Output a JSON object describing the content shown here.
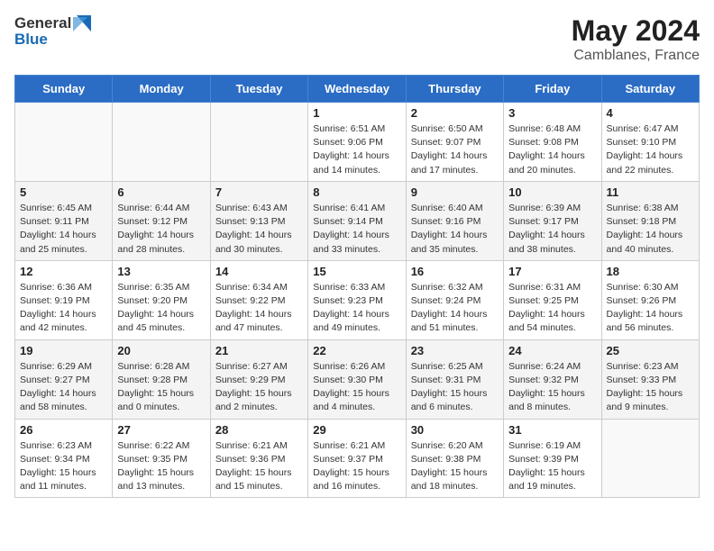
{
  "header": {
    "logo_line1": "General",
    "logo_line2": "Blue",
    "month": "May 2024",
    "location": "Camblanes, France"
  },
  "weekdays": [
    "Sunday",
    "Monday",
    "Tuesday",
    "Wednesday",
    "Thursday",
    "Friday",
    "Saturday"
  ],
  "weeks": [
    [
      {
        "day": "",
        "info": ""
      },
      {
        "day": "",
        "info": ""
      },
      {
        "day": "",
        "info": ""
      },
      {
        "day": "1",
        "info": "Sunrise: 6:51 AM\nSunset: 9:06 PM\nDaylight: 14 hours\nand 14 minutes."
      },
      {
        "day": "2",
        "info": "Sunrise: 6:50 AM\nSunset: 9:07 PM\nDaylight: 14 hours\nand 17 minutes."
      },
      {
        "day": "3",
        "info": "Sunrise: 6:48 AM\nSunset: 9:08 PM\nDaylight: 14 hours\nand 20 minutes."
      },
      {
        "day": "4",
        "info": "Sunrise: 6:47 AM\nSunset: 9:10 PM\nDaylight: 14 hours\nand 22 minutes."
      }
    ],
    [
      {
        "day": "5",
        "info": "Sunrise: 6:45 AM\nSunset: 9:11 PM\nDaylight: 14 hours\nand 25 minutes."
      },
      {
        "day": "6",
        "info": "Sunrise: 6:44 AM\nSunset: 9:12 PM\nDaylight: 14 hours\nand 28 minutes."
      },
      {
        "day": "7",
        "info": "Sunrise: 6:43 AM\nSunset: 9:13 PM\nDaylight: 14 hours\nand 30 minutes."
      },
      {
        "day": "8",
        "info": "Sunrise: 6:41 AM\nSunset: 9:14 PM\nDaylight: 14 hours\nand 33 minutes."
      },
      {
        "day": "9",
        "info": "Sunrise: 6:40 AM\nSunset: 9:16 PM\nDaylight: 14 hours\nand 35 minutes."
      },
      {
        "day": "10",
        "info": "Sunrise: 6:39 AM\nSunset: 9:17 PM\nDaylight: 14 hours\nand 38 minutes."
      },
      {
        "day": "11",
        "info": "Sunrise: 6:38 AM\nSunset: 9:18 PM\nDaylight: 14 hours\nand 40 minutes."
      }
    ],
    [
      {
        "day": "12",
        "info": "Sunrise: 6:36 AM\nSunset: 9:19 PM\nDaylight: 14 hours\nand 42 minutes."
      },
      {
        "day": "13",
        "info": "Sunrise: 6:35 AM\nSunset: 9:20 PM\nDaylight: 14 hours\nand 45 minutes."
      },
      {
        "day": "14",
        "info": "Sunrise: 6:34 AM\nSunset: 9:22 PM\nDaylight: 14 hours\nand 47 minutes."
      },
      {
        "day": "15",
        "info": "Sunrise: 6:33 AM\nSunset: 9:23 PM\nDaylight: 14 hours\nand 49 minutes."
      },
      {
        "day": "16",
        "info": "Sunrise: 6:32 AM\nSunset: 9:24 PM\nDaylight: 14 hours\nand 51 minutes."
      },
      {
        "day": "17",
        "info": "Sunrise: 6:31 AM\nSunset: 9:25 PM\nDaylight: 14 hours\nand 54 minutes."
      },
      {
        "day": "18",
        "info": "Sunrise: 6:30 AM\nSunset: 9:26 PM\nDaylight: 14 hours\nand 56 minutes."
      }
    ],
    [
      {
        "day": "19",
        "info": "Sunrise: 6:29 AM\nSunset: 9:27 PM\nDaylight: 14 hours\nand 58 minutes."
      },
      {
        "day": "20",
        "info": "Sunrise: 6:28 AM\nSunset: 9:28 PM\nDaylight: 15 hours\nand 0 minutes."
      },
      {
        "day": "21",
        "info": "Sunrise: 6:27 AM\nSunset: 9:29 PM\nDaylight: 15 hours\nand 2 minutes."
      },
      {
        "day": "22",
        "info": "Sunrise: 6:26 AM\nSunset: 9:30 PM\nDaylight: 15 hours\nand 4 minutes."
      },
      {
        "day": "23",
        "info": "Sunrise: 6:25 AM\nSunset: 9:31 PM\nDaylight: 15 hours\nand 6 minutes."
      },
      {
        "day": "24",
        "info": "Sunrise: 6:24 AM\nSunset: 9:32 PM\nDaylight: 15 hours\nand 8 minutes."
      },
      {
        "day": "25",
        "info": "Sunrise: 6:23 AM\nSunset: 9:33 PM\nDaylight: 15 hours\nand 9 minutes."
      }
    ],
    [
      {
        "day": "26",
        "info": "Sunrise: 6:23 AM\nSunset: 9:34 PM\nDaylight: 15 hours\nand 11 minutes."
      },
      {
        "day": "27",
        "info": "Sunrise: 6:22 AM\nSunset: 9:35 PM\nDaylight: 15 hours\nand 13 minutes."
      },
      {
        "day": "28",
        "info": "Sunrise: 6:21 AM\nSunset: 9:36 PM\nDaylight: 15 hours\nand 15 minutes."
      },
      {
        "day": "29",
        "info": "Sunrise: 6:21 AM\nSunset: 9:37 PM\nDaylight: 15 hours\nand 16 minutes."
      },
      {
        "day": "30",
        "info": "Sunrise: 6:20 AM\nSunset: 9:38 PM\nDaylight: 15 hours\nand 18 minutes."
      },
      {
        "day": "31",
        "info": "Sunrise: 6:19 AM\nSunset: 9:39 PM\nDaylight: 15 hours\nand 19 minutes."
      },
      {
        "day": "",
        "info": ""
      }
    ]
  ]
}
